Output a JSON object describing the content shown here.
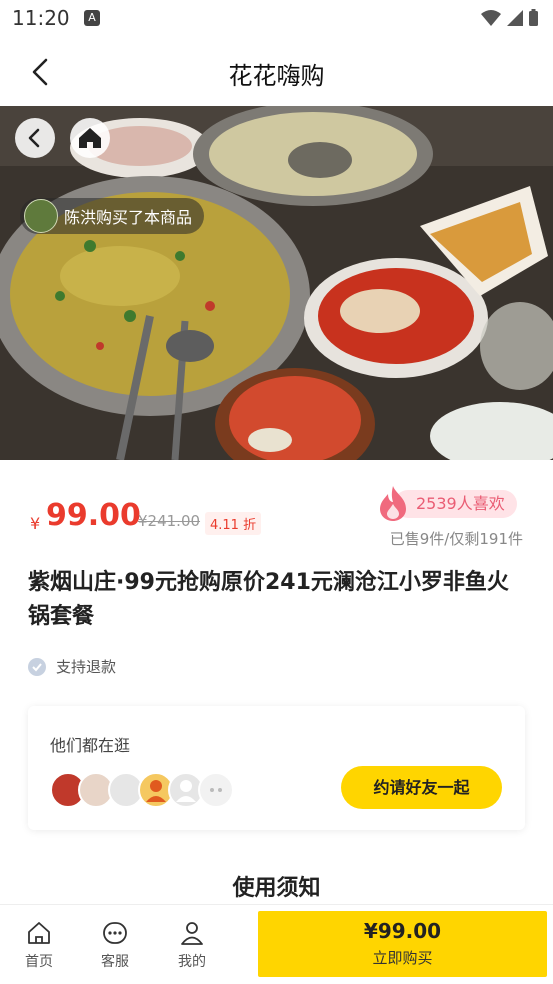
{
  "status_bar": {
    "time": "11:20",
    "notification_glyph": "A"
  },
  "nav": {
    "title": "花花嗨购"
  },
  "hero": {
    "buyer_notice": "陈洪购买了本商品"
  },
  "price": {
    "currency": "¥",
    "current": "99.00",
    "original": "¥241.00",
    "discount": "4.11 折",
    "likes": "2539人喜欢",
    "sold_info": "已售9件/仅剩191件"
  },
  "product": {
    "title": "紫烟山庄·99元抢购原价241元澜沧江小罗非鱼火锅套餐"
  },
  "refund": {
    "label": "支持退款"
  },
  "browse": {
    "label": "他们都在逛",
    "invite_label": "约请好友一起"
  },
  "section": {
    "title": "使用须知"
  },
  "tabs": [
    {
      "label": "首页"
    },
    {
      "label": "客服"
    },
    {
      "label": "我的"
    }
  ],
  "buy": {
    "price": "¥99.00",
    "label": "立即购买"
  },
  "colors": {
    "accent_red": "#ea3b2d",
    "accent_yellow": "#ffd500",
    "likes_pink": "#ea5d74"
  }
}
